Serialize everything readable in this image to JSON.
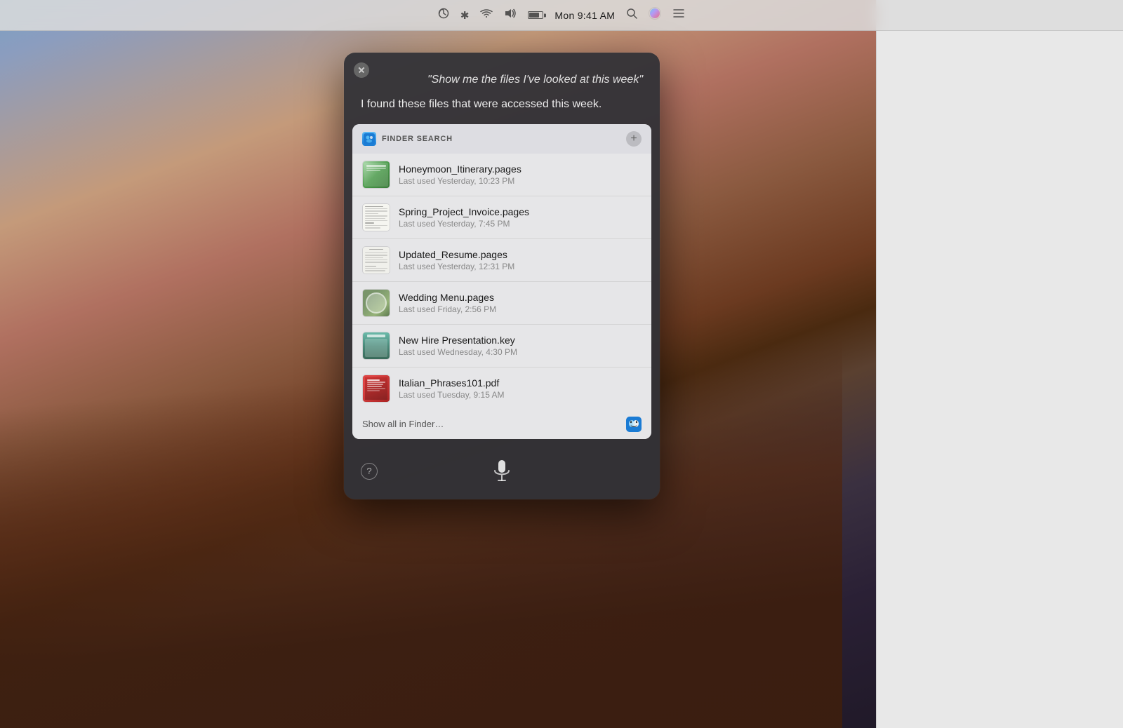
{
  "desktop": {
    "description": "macOS Sierra desktop with mountain wallpaper"
  },
  "menubar": {
    "time": "Mon 9:41 AM",
    "icons": {
      "time_machine": "⏱",
      "bluetooth": "✦",
      "wifi": "wifi",
      "volume": "volume",
      "battery": "battery",
      "search": "🔍",
      "siri": "siri",
      "menu": "menu"
    }
  },
  "siri": {
    "close_label": "×",
    "query": "\"Show me the files I've looked at this week\"",
    "response": "I found these files that were accessed this week.",
    "finder_search_title": "FINDER SEARCH",
    "add_button_label": "+",
    "files": [
      {
        "name": "Honeymoon_Itinerary.pages",
        "meta": "Last used Yesterday, 10:23 PM",
        "thumb_type": "pages-honey"
      },
      {
        "name": "Spring_Project_Invoice.pages",
        "meta": "Last used Yesterday, 7:45 PM",
        "thumb_type": "pages-invoice"
      },
      {
        "name": "Updated_Resume.pages",
        "meta": "Last used Yesterday, 12:31 PM",
        "thumb_type": "pages-resume"
      },
      {
        "name": "Wedding Menu.pages",
        "meta": "Last used Friday, 2:56 PM",
        "thumb_type": "wedding"
      },
      {
        "name": "New Hire Presentation.key",
        "meta": "Last used Wednesday, 4:30 PM",
        "thumb_type": "key"
      },
      {
        "name": "Italian_Phrases101.pdf",
        "meta": "Last used Tuesday, 9:15 AM",
        "thumb_type": "pdf"
      }
    ],
    "show_all_label": "Show all in Finder…",
    "help_label": "?",
    "mic_label": "microphone"
  }
}
